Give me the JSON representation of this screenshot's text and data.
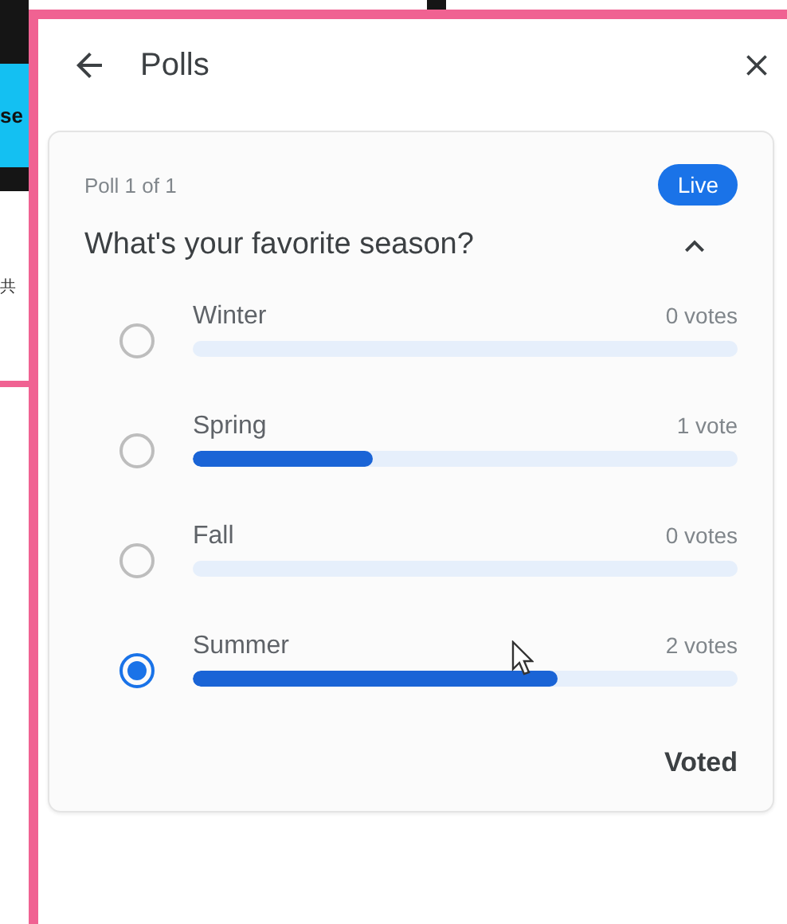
{
  "background": {
    "banner_text": "se",
    "sidebar_text": "共"
  },
  "header": {
    "title": "Polls"
  },
  "poll": {
    "counter": "Poll 1 of 1",
    "status": "Live",
    "question": "What's your favorite season?",
    "expanded": true,
    "options": [
      {
        "label": "Winter",
        "votes": "0 votes",
        "selected": false
      },
      {
        "label": "Spring",
        "votes": "1 vote",
        "level": 0.33,
        "selected": false
      },
      {
        "label": "Fall",
        "votes": "0 votes",
        "selected": false
      },
      {
        "label": "Summer",
        "votes": "2 votes",
        "level": 0.67,
        "selected": true
      }
    ],
    "footer": "Voted"
  }
}
